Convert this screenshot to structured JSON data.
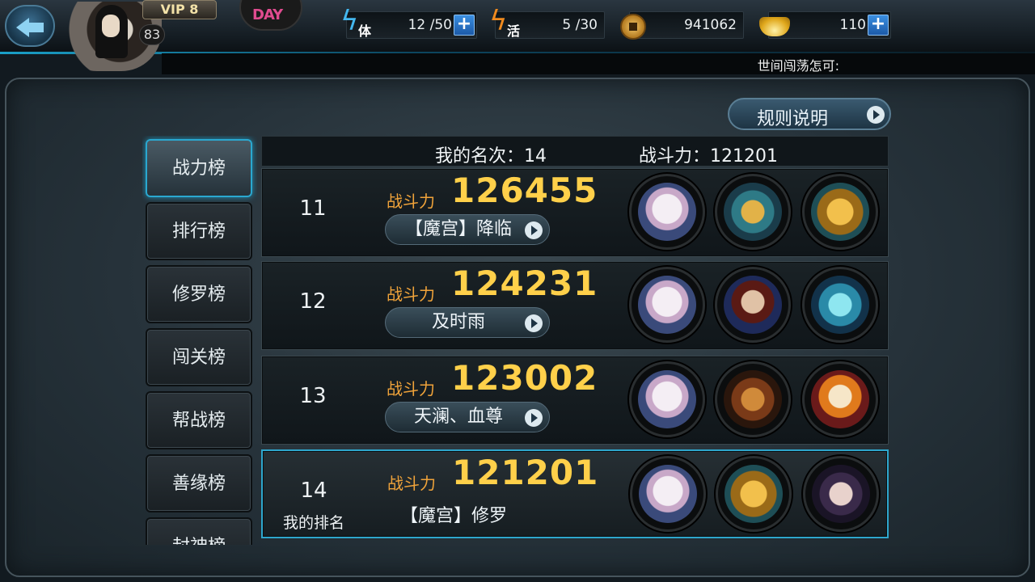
{
  "top_bar": {
    "vip": "VIP 8",
    "level": "83",
    "event_badge": "DAY",
    "stamina": {
      "label": "体",
      "value": "12 /50"
    },
    "vitality": {
      "label": "活",
      "value": "5 /30"
    },
    "copper": {
      "value": "941062"
    },
    "gold": {
      "value": "110"
    },
    "plus_symbol": "+",
    "motto": "世间闯荡怎可:"
  },
  "rules_button": "规则说明",
  "tabs": [
    {
      "label": "战力榜",
      "active": true
    },
    {
      "label": "排行榜"
    },
    {
      "label": "修罗榜"
    },
    {
      "label": "闯关榜"
    },
    {
      "label": "帮战榜"
    },
    {
      "label": "善缘榜"
    },
    {
      "label": "封神榜"
    }
  ],
  "summary": {
    "my_rank": "我的名次：14",
    "my_power": "战斗力：121201"
  },
  "power_label": "战斗力",
  "rows": [
    {
      "rank": "11",
      "power": "126455",
      "guild": "【魔宫】降临",
      "heroes": [
        "white-haired-girl-portrait",
        "golden-helmet-warrior-portrait",
        "golden-lion-portrait"
      ]
    },
    {
      "rank": "12",
      "power": "124231",
      "guild": "及时雨",
      "heroes": [
        "white-haired-girl-portrait",
        "red-robed-warrior-portrait",
        "ice-beast-portrait"
      ]
    },
    {
      "rank": "13",
      "power": "123002",
      "guild": "天澜、血尊",
      "heroes": [
        "white-haired-girl-portrait",
        "lion-demon-portrait",
        "fire-ape-portrait"
      ]
    },
    {
      "rank": "14",
      "mine_label": "我的排名",
      "power": "121201",
      "guild": "【魔宫】修罗",
      "heroes": [
        "white-haired-girl-portrait",
        "golden-lion-portrait",
        "hatted-mage-portrait"
      ]
    }
  ],
  "colors": {
    "accent": "#2aa8d0",
    "power_label": "#f0a33a",
    "power_value": "#ffd04a"
  }
}
